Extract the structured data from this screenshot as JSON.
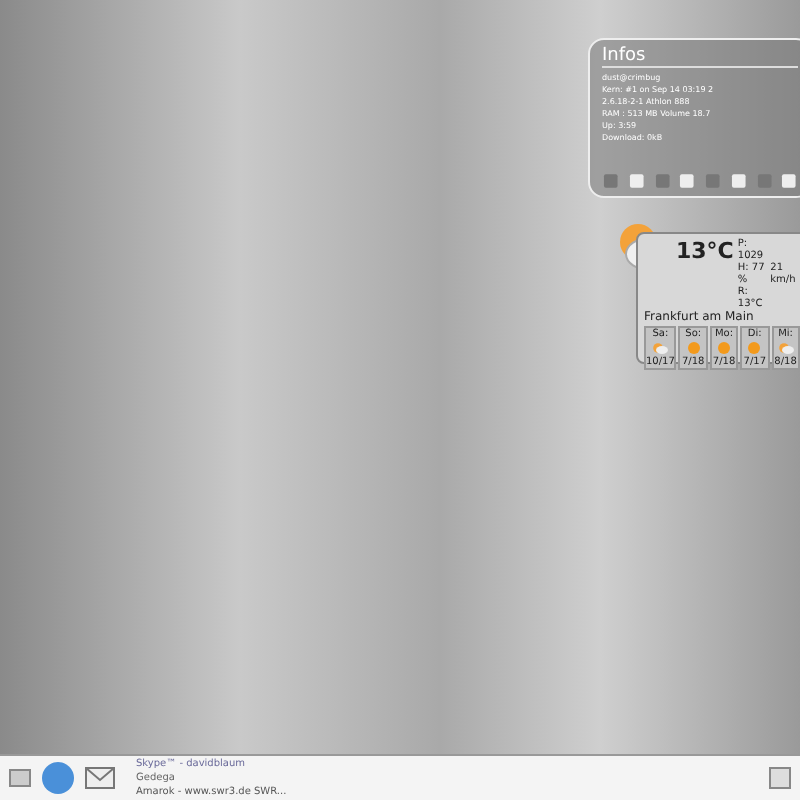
{
  "infos": {
    "title": "Infos",
    "lines": [
      "dust@crimbug",
      "Kern: #1 on Sep 14 03:19 2",
      "2.6.18-2-1 Athlon 888",
      "RAM : 513 MB Volume 18.7",
      "Up: 3:59",
      "Download: 0kB"
    ]
  },
  "weather": {
    "temperature": "13°C",
    "pressure": "P: 1029",
    "humidity": "H: 77 %",
    "feels": "R: 13°C",
    "wind": "21 km/h",
    "city": "Frankfurt am Main",
    "days": [
      {
        "day": "Sa:",
        "temps": "10/17",
        "kind": "cloudy"
      },
      {
        "day": "So:",
        "temps": "7/18",
        "kind": "sunny"
      },
      {
        "day": "Mo:",
        "temps": "7/18",
        "kind": "sunny"
      },
      {
        "day": "Di:",
        "temps": "7/17",
        "kind": "sunny"
      },
      {
        "day": "Mi:",
        "temps": "8/18",
        "kind": "cloudy"
      }
    ]
  },
  "taskbar": {
    "tasks": [
      {
        "label": "Skype™ - davidblaum",
        "kind": "skype"
      },
      {
        "label": "Gedega",
        "kind": "app"
      },
      {
        "label": "Amarok - www.swr3.de SWR...",
        "kind": "music"
      }
    ]
  }
}
